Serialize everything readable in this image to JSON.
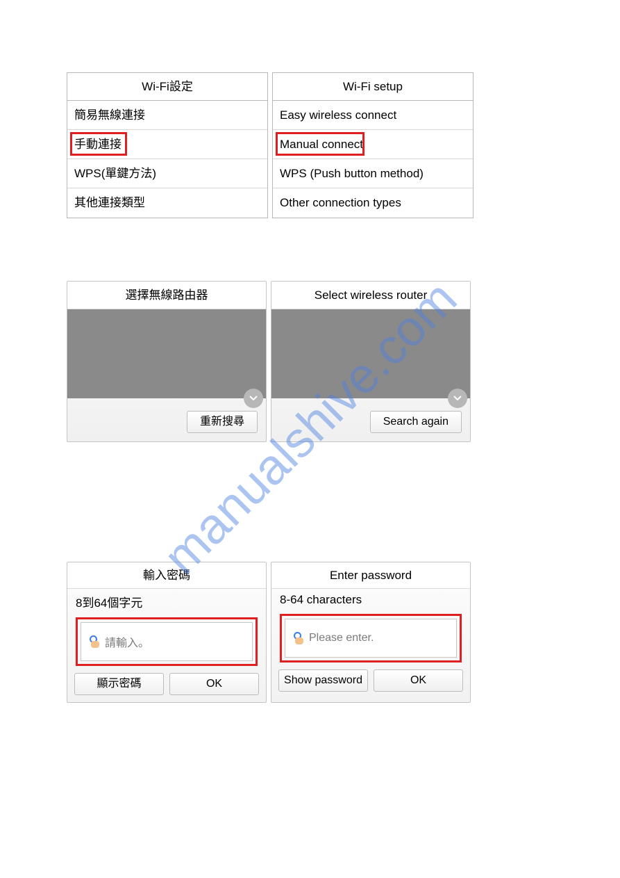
{
  "watermark": "manualshive.com",
  "panel1": {
    "left": {
      "title": "Wi-Fi設定",
      "items": [
        "簡易無線連接",
        "手動連接",
        "WPS(單鍵方法)",
        "其他連接類型"
      ],
      "highlighted_index": 1
    },
    "right": {
      "title": "Wi-Fi setup",
      "items": [
        "Easy wireless connect",
        "Manual connect",
        "WPS (Push button method)",
        "Other connection types"
      ],
      "highlighted_index": 1
    }
  },
  "panel2": {
    "left": {
      "title": "選擇無線路由器",
      "search_btn": "重新搜尋"
    },
    "right": {
      "title": "Select wireless router",
      "search_btn": "Search again"
    }
  },
  "panel3": {
    "left": {
      "title": "輸入密碼",
      "sub": "8到64個字元",
      "placeholder": "請輸入。",
      "show_btn": "顯示密碼",
      "ok_btn": "OK"
    },
    "right": {
      "title": "Enter password",
      "sub": "8-64 characters",
      "placeholder": "Please enter.",
      "show_btn": "Show password",
      "ok_btn": "OK"
    }
  }
}
